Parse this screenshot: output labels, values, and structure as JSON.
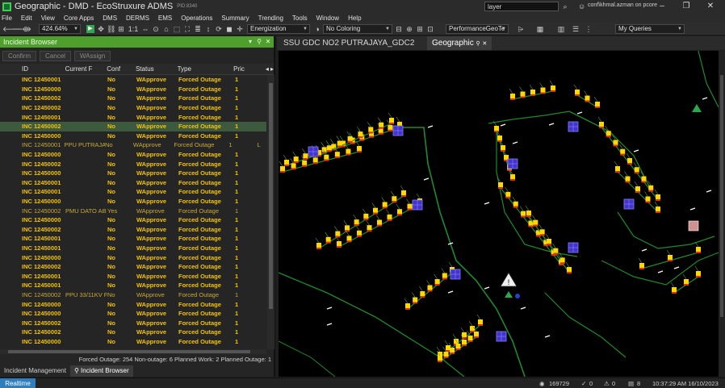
{
  "window": {
    "title": "Geographic - DMD - EcoStruxure ADMS",
    "pid": "PID:8340",
    "search_value": "layer",
    "user": "conf\\khmal.azman on pcore"
  },
  "menu": [
    "File",
    "Edit",
    "View",
    "Core Apps",
    "DMS",
    "DERMS",
    "EMS",
    "Operations",
    "Summary",
    "Trending",
    "Tools",
    "Window",
    "Help"
  ],
  "toolbar": {
    "zoom": "424.64%",
    "mode": "Energization",
    "coloring": "No Coloring",
    "view": "PerformanceGeoTe",
    "queries": "My Queries"
  },
  "incident_browser": {
    "title": "Incident Browser",
    "actions": [
      "Confirm",
      "Cancel",
      "WAssign"
    ],
    "columns": [
      "ID",
      "Current F",
      "Conf",
      "Status",
      "Type",
      "Pric"
    ],
    "rows": [
      {
        "id": "INC 12450001",
        "facility": "",
        "conf": "No",
        "status": "WApprove",
        "type": "Forced Outage",
        "priority": "1",
        "style": "bold"
      },
      {
        "id": "INC 12450000",
        "facility": "",
        "conf": "No",
        "status": "WApprove",
        "type": "Forced Outage",
        "priority": "1",
        "style": "bold"
      },
      {
        "id": "INC 12450002",
        "facility": "",
        "conf": "No",
        "status": "WApprove",
        "type": "Forced Outage",
        "priority": "1",
        "style": "bold"
      },
      {
        "id": "INC 12450002",
        "facility": "",
        "conf": "No",
        "status": "WApprove",
        "type": "Forced Outage",
        "priority": "1",
        "style": "bold"
      },
      {
        "id": "INC 12450001",
        "facility": "",
        "conf": "No",
        "status": "WApprove",
        "type": "Forced Outage",
        "priority": "1",
        "style": "bold"
      },
      {
        "id": "INC 12450002",
        "facility": "",
        "conf": "No",
        "status": "WApprove",
        "type": "Forced Outage",
        "priority": "1",
        "style": "bold",
        "selected": true
      },
      {
        "id": "INC 12450000",
        "facility": "",
        "conf": "No",
        "status": "WApprove",
        "type": "Forced Outage",
        "priority": "1",
        "style": "bold"
      },
      {
        "id": "INC 12450001",
        "facility": "PPU PUTRAJAYA",
        "conf": "No",
        "status": "WApprove",
        "type": "Forced Outage",
        "priority": "1",
        "extra": "L",
        "style": "normal"
      },
      {
        "id": "INC 12450000",
        "facility": "",
        "conf": "No",
        "status": "WApprove",
        "type": "Forced Outage",
        "priority": "1",
        "style": "bold"
      },
      {
        "id": "INC 12450002",
        "facility": "",
        "conf": "No",
        "status": "WApprove",
        "type": "Forced Outage",
        "priority": "1",
        "style": "bold"
      },
      {
        "id": "INC 12450000",
        "facility": "",
        "conf": "No",
        "status": "WApprove",
        "type": "Forced Outage",
        "priority": "1",
        "style": "bold"
      },
      {
        "id": "INC 12450001",
        "facility": "",
        "conf": "No",
        "status": "WApprove",
        "type": "Forced Outage",
        "priority": "1",
        "style": "bold"
      },
      {
        "id": "INC 12450001",
        "facility": "",
        "conf": "No",
        "status": "WApprove",
        "type": "Forced Outage",
        "priority": "1",
        "style": "bold"
      },
      {
        "id": "INC 12450000",
        "facility": "",
        "conf": "No",
        "status": "WApprove",
        "type": "Forced Outage",
        "priority": "1",
        "style": "bold"
      },
      {
        "id": "INC 12450002",
        "facility": "PMU DATO AB",
        "conf": "Yes",
        "status": "WApprove",
        "type": "Forced Outage",
        "priority": "1",
        "style": "normal"
      },
      {
        "id": "INC 12450000",
        "facility": "",
        "conf": "No",
        "status": "WApprove",
        "type": "Forced Outage",
        "priority": "1",
        "style": "bold"
      },
      {
        "id": "INC 12450002",
        "facility": "",
        "conf": "No",
        "status": "WApprove",
        "type": "Forced Outage",
        "priority": "1",
        "style": "bold"
      },
      {
        "id": "INC 12450001",
        "facility": "",
        "conf": "No",
        "status": "WApprove",
        "type": "Forced Outage",
        "priority": "1",
        "style": "bold"
      },
      {
        "id": "INC 12450001",
        "facility": "",
        "conf": "No",
        "status": "WApprove",
        "type": "Forced Outage",
        "priority": "1",
        "style": "bold"
      },
      {
        "id": "INC 12450000",
        "facility": "",
        "conf": "No",
        "status": "WApprove",
        "type": "Forced Outage",
        "priority": "1",
        "style": "bold"
      },
      {
        "id": "INC 12450002",
        "facility": "",
        "conf": "No",
        "status": "WApprove",
        "type": "Forced Outage",
        "priority": "1",
        "style": "bold"
      },
      {
        "id": "INC 12450001",
        "facility": "",
        "conf": "No",
        "status": "WApprove",
        "type": "Forced Outage",
        "priority": "1",
        "style": "bold"
      },
      {
        "id": "INC 12450001",
        "facility": "",
        "conf": "No",
        "status": "WApprove",
        "type": "Forced Outage",
        "priority": "1",
        "style": "bold"
      },
      {
        "id": "INC 12450002",
        "facility": "PPU 33/11KV F",
        "conf": "No",
        "status": "WApprove",
        "type": "Forced Outage",
        "priority": "1",
        "style": "normal"
      },
      {
        "id": "INC 12450000",
        "facility": "",
        "conf": "No",
        "status": "WApprove",
        "type": "Forced Outage",
        "priority": "1",
        "style": "bold"
      },
      {
        "id": "INC 12450000",
        "facility": "",
        "conf": "No",
        "status": "WApprove",
        "type": "Forced Outage",
        "priority": "1",
        "style": "bold"
      },
      {
        "id": "INC 12450002",
        "facility": "",
        "conf": "No",
        "status": "WApprove",
        "type": "Forced Outage",
        "priority": "1",
        "style": "bold"
      },
      {
        "id": "INC 12450002",
        "facility": "",
        "conf": "No",
        "status": "WApprove",
        "type": "Forced Outage",
        "priority": "1",
        "style": "bold"
      },
      {
        "id": "INC 12450000",
        "facility": "",
        "conf": "No",
        "status": "WApprove",
        "type": "Forced Outage",
        "priority": "1",
        "style": "bold"
      }
    ],
    "summary": "Forced Outage: 254   Non-outage: 6   Planned Work: 2   Planned Outage: 1",
    "tabs": [
      "Incident Management",
      "Incident Browser"
    ]
  },
  "map": {
    "tabs": [
      "SSU GDC NO2 PUTRAJAYA_GDC2",
      "Geographic"
    ],
    "line_color": "#1f8a2a",
    "device_color": "#ffd800",
    "substation_color": "#4433cc"
  },
  "status": {
    "mode": "Realtime",
    "count": "169729",
    "checks": "0",
    "alerts": "0",
    "users": "8",
    "datetime": "10:37:29 AM 16/10/2023"
  }
}
